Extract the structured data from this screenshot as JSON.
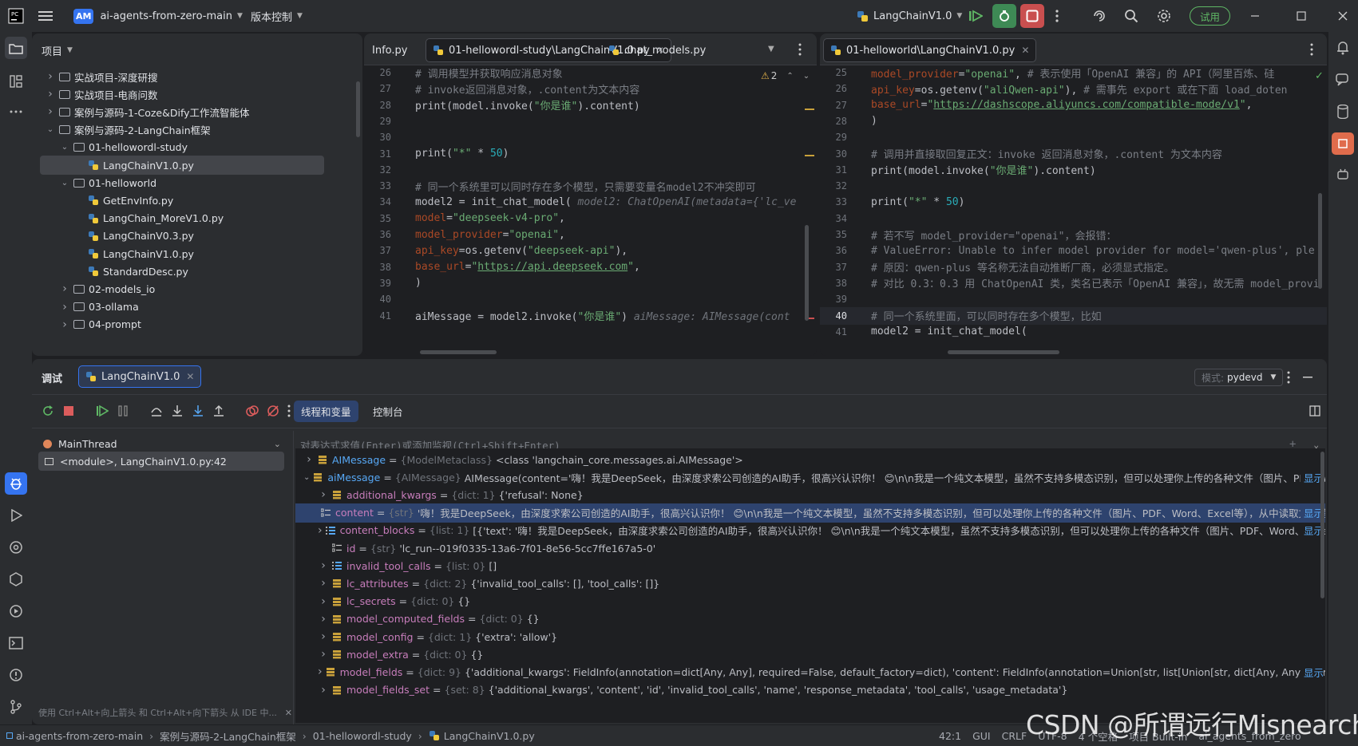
{
  "titlebar": {
    "project_badge": "AM",
    "project_name": "ai-agents-from-zero-main",
    "vcs_menu": "版本控制",
    "run_config": "LangChainV1.0",
    "trial_button": "试用"
  },
  "project_panel": {
    "title": "项目",
    "items": [
      {
        "label": "实战项目-深度研搜",
        "kind": "folder",
        "expanded": false
      },
      {
        "label": "实战项目-电商问数",
        "kind": "folder",
        "expanded": false
      },
      {
        "label": "案例与源码-1-Coze&Dify工作流智能体",
        "kind": "folder",
        "expanded": false
      },
      {
        "label": "案例与源码-2-LangChain框架",
        "kind": "folder",
        "expanded": true
      },
      {
        "label": "01-hellowordl-study",
        "kind": "folder",
        "expanded": true
      },
      {
        "label": "LangChainV1.0.py",
        "kind": "py",
        "selected": true
      },
      {
        "label": "01-helloworld",
        "kind": "folder",
        "expanded": true
      },
      {
        "label": "GetEnvInfo.py",
        "kind": "py"
      },
      {
        "label": "LangChain_MoreV1.0.py",
        "kind": "py"
      },
      {
        "label": "LangChainV0.3.py",
        "kind": "py"
      },
      {
        "label": "LangChainV1.0.py",
        "kind": "py"
      },
      {
        "label": "StandardDesc.py",
        "kind": "py"
      },
      {
        "label": "02-models_io",
        "kind": "folder",
        "expanded": false
      },
      {
        "label": "03-ollama",
        "kind": "folder",
        "expanded": false
      },
      {
        "label": "04-prompt",
        "kind": "folder",
        "expanded": false
      }
    ]
  },
  "editor1": {
    "tabs": [
      "Info.py",
      "01-hellowordl-study\\LangChainV1.0.py",
      "chat_models.py"
    ],
    "warnings": "2",
    "lines": [
      {
        "n": "26",
        "parts": [
          [
            "cm",
            "# 调用模型并获取响应消息对象"
          ]
        ]
      },
      {
        "n": "27",
        "parts": [
          [
            "cm",
            "# invoke返回消息对象，.content为文本内容"
          ]
        ]
      },
      {
        "n": "28",
        "parts": [
          [
            "fn",
            "print(model.invoke("
          ],
          [
            "str",
            "\"你是谁\""
          ],
          [
            "fn",
            ").content)"
          ]
        ]
      },
      {
        "n": "29",
        "parts": []
      },
      {
        "n": "30",
        "parts": []
      },
      {
        "n": "31",
        "parts": [
          [
            "fn",
            "print("
          ],
          [
            "str",
            "\"*\""
          ],
          [
            "fn",
            " * "
          ],
          [
            "num",
            "50"
          ],
          [
            "fn",
            ")"
          ]
        ]
      },
      {
        "n": "32",
        "parts": []
      },
      {
        "n": "33",
        "parts": [
          [
            "cm",
            "# 同一个系统里可以同时存在多个模型，只需要变量名model2不冲突即可"
          ]
        ]
      },
      {
        "n": "34",
        "parts": [
          [
            "fn",
            "model2 = init_chat_model(  "
          ],
          [
            "hint",
            "model2: ChatOpenAI(metadata={'lc_ve"
          ]
        ]
      },
      {
        "n": "35",
        "parts": [
          [
            "fn",
            "    "
          ],
          [
            "named",
            "model"
          ],
          [
            "fn",
            "="
          ],
          [
            "str",
            "\"deepseek-v4-pro\""
          ],
          [
            "fn",
            ","
          ]
        ]
      },
      {
        "n": "36",
        "parts": [
          [
            "fn",
            "    "
          ],
          [
            "named",
            "model_provider"
          ],
          [
            "fn",
            "="
          ],
          [
            "str",
            "\"openai\""
          ],
          [
            "fn",
            ","
          ]
        ]
      },
      {
        "n": "37",
        "parts": [
          [
            "fn",
            "    "
          ],
          [
            "named",
            "api_key"
          ],
          [
            "fn",
            "=os.getenv("
          ],
          [
            "str",
            "\"deepseek-api\""
          ],
          [
            "fn",
            "),"
          ]
        ]
      },
      {
        "n": "38",
        "parts": [
          [
            "fn",
            "    "
          ],
          [
            "named",
            "base_url"
          ],
          [
            "fn",
            "="
          ],
          [
            "str",
            "\""
          ],
          [
            "url",
            "https://api.deepseek.com"
          ],
          [
            "str",
            "\""
          ],
          [
            "fn",
            ","
          ]
        ]
      },
      {
        "n": "39",
        "parts": [
          [
            "fn",
            ")"
          ]
        ]
      },
      {
        "n": "40",
        "parts": []
      },
      {
        "n": "41",
        "parts": [
          [
            "fn",
            "aiMessage =  model2.invoke("
          ],
          [
            "str",
            "\"你是谁\""
          ],
          [
            "fn",
            ")  "
          ],
          [
            "hint",
            "aiMessage: AIMessage(cont"
          ]
        ]
      }
    ]
  },
  "editor2": {
    "tab": "01-helloworld\\LangChainV1.0.py",
    "lines": [
      {
        "n": "25",
        "parts": [
          [
            "fn",
            "    "
          ],
          [
            "named",
            "model_provider"
          ],
          [
            "fn",
            "="
          ],
          [
            "str",
            "\"openai\""
          ],
          [
            "fn",
            ",  "
          ],
          [
            "cm",
            "# 表示使用「OpenAI 兼容」的 API（阿里百炼、硅"
          ]
        ]
      },
      {
        "n": "26",
        "parts": [
          [
            "fn",
            "    "
          ],
          [
            "named",
            "api_key"
          ],
          [
            "fn",
            "=os.getenv("
          ],
          [
            "str",
            "\"aliQwen-api\""
          ],
          [
            "fn",
            "),  "
          ],
          [
            "cm",
            "# 需事先 export 或在下面 load_doten"
          ]
        ]
      },
      {
        "n": "27",
        "parts": [
          [
            "fn",
            "    "
          ],
          [
            "named",
            "base_url"
          ],
          [
            "fn",
            "="
          ],
          [
            "str",
            "\""
          ],
          [
            "url",
            "https://dashscope.aliyuncs.com/compatible-mode/v1"
          ],
          [
            "str",
            "\""
          ],
          [
            "fn",
            ","
          ]
        ]
      },
      {
        "n": "28",
        "parts": [
          [
            "fn",
            ")"
          ]
        ]
      },
      {
        "n": "29",
        "parts": []
      },
      {
        "n": "30",
        "parts": [
          [
            "cm",
            "# 调用并直接取回复正文：invoke 返回消息对象，.content 为文本内容"
          ]
        ]
      },
      {
        "n": "31",
        "parts": [
          [
            "fn",
            "print(model.invoke("
          ],
          [
            "str",
            "\"你是谁\""
          ],
          [
            "fn",
            ").content)"
          ]
        ]
      },
      {
        "n": "32",
        "parts": []
      },
      {
        "n": "33",
        "parts": [
          [
            "fn",
            "print("
          ],
          [
            "str",
            "\"*\""
          ],
          [
            "fn",
            " * "
          ],
          [
            "num",
            "50"
          ],
          [
            "fn",
            ")"
          ]
        ]
      },
      {
        "n": "34",
        "parts": []
      },
      {
        "n": "35",
        "parts": [
          [
            "cm",
            "# 若不写 model_provider=\"openai\"，会报错："
          ]
        ]
      },
      {
        "n": "36",
        "parts": [
          [
            "cm",
            "# ValueError: Unable to infer model provider for model='qwen-plus', ple"
          ]
        ]
      },
      {
        "n": "37",
        "parts": [
          [
            "cm",
            "# 原因：qwen-plus 等名称无法自动推断厂商，必须显式指定。"
          ]
        ]
      },
      {
        "n": "38",
        "parts": [
          [
            "cm",
            "# 对比 0.3：0.3 用 ChatOpenAI 类，类名已表示「OpenAI 兼容」，故无需 model_provi"
          ]
        ]
      },
      {
        "n": "39",
        "parts": []
      },
      {
        "n": "40",
        "parts": [
          [
            "cm",
            "# 同一个系统里面，可以同时存在多个模型，比如"
          ]
        ]
      },
      {
        "n": "41",
        "parts": [
          [
            "fn",
            "model2 = init_chat_model("
          ]
        ]
      }
    ]
  },
  "debug": {
    "title": "调试",
    "session_tab": "LangChainV1.0",
    "mode_label": "模式:",
    "mode_value": "pydevd",
    "subtab_vars": "线程和变量",
    "subtab_console": "控制台",
    "thread": "MainThread",
    "frame": "<module>, LangChainV1.0.py:42",
    "hint_text": "使用 Ctrl+Alt+向上箭头 和 Ctrl+Alt+向下箭头 从 IDE 中...",
    "eval_placeholder": "对表达式求值(Enter)或添加监视(Ctrl+Shift+Enter)",
    "variables": [
      {
        "indent": 0,
        "chev": "right",
        "name": "AIMessage",
        "type": "{ModelMetaclass}",
        "value": "<class 'langchain_core.messages.ai.AIMessage'>",
        "show": false,
        "icon": "var"
      },
      {
        "indent": 0,
        "chev": "down",
        "name": "aiMessage",
        "type": "{AIMessage}",
        "value": "AIMessage(content='嗨！我是DeepSeek，由深度求索公司创造的AI助手，很高兴认识你！ 😊\\n\\n我是一个纯文本模型，虽然不支持多模态识别，但可以处理你上传的各种文件（图片、PDF、Wor...",
        "show": true,
        "icon": "var"
      },
      {
        "indent": 1,
        "chev": "right",
        "name": "additional_kwargs",
        "type": "{dict: 1}",
        "value": "{'refusal': None}",
        "show": false,
        "icon": "var"
      },
      {
        "indent": 1,
        "chev": "none",
        "name": "content",
        "type": "{str}",
        "value": "'嗨！我是DeepSeek，由深度求索公司创造的AI助手，很高兴认识你！ 😊\\n\\n我是一个纯文本模型，虽然不支持多模态识别，但可以处理你上传的各种文件（图片、PDF、Word、Excel等），从中读取文字信...",
        "show": true,
        "selected": true,
        "icon": "field"
      },
      {
        "indent": 1,
        "chev": "right",
        "name": "content_blocks",
        "type": "{list: 1}",
        "value": "[{'text': '嗨！我是DeepSeek，由深度求索公司创造的AI助手，很高兴认识你！ 😊\\n\\n我是一个纯文本模型，虽然不支持多模态识别，但可以处理你上传的各种文件（图片、PDF、Word、Excel等）...",
        "show": true,
        "icon": "list"
      },
      {
        "indent": 1,
        "chev": "none",
        "name": "id",
        "type": "{str}",
        "value": "'lc_run--019f0335-13a6-7f01-8e56-5cc7ffe167a5-0'",
        "show": false,
        "icon": "field"
      },
      {
        "indent": 1,
        "chev": "right",
        "name": "invalid_tool_calls",
        "type": "{list: 0}",
        "value": "[]",
        "show": false,
        "icon": "list"
      },
      {
        "indent": 1,
        "chev": "right",
        "name": "lc_attributes",
        "type": "{dict: 2}",
        "value": "{'invalid_tool_calls': [], 'tool_calls': []}",
        "show": false,
        "icon": "var"
      },
      {
        "indent": 1,
        "chev": "right",
        "name": "lc_secrets",
        "type": "{dict: 0}",
        "value": "{}",
        "show": false,
        "icon": "var"
      },
      {
        "indent": 1,
        "chev": "right",
        "name": "model_computed_fields",
        "type": "{dict: 0}",
        "value": "{}",
        "show": false,
        "icon": "var"
      },
      {
        "indent": 1,
        "chev": "right",
        "name": "model_config",
        "type": "{dict: 1}",
        "value": "{'extra': 'allow'}",
        "show": false,
        "icon": "var"
      },
      {
        "indent": 1,
        "chev": "right",
        "name": "model_extra",
        "type": "{dict: 0}",
        "value": "{}",
        "show": false,
        "icon": "var"
      },
      {
        "indent": 1,
        "chev": "right",
        "name": "model_fields",
        "type": "{dict: 9}",
        "value": "{'additional_kwargs': FieldInfo(annotation=dict[Any, Any], required=False, default_factory=dict), 'content': FieldInfo(annotation=Union[str, list[Union[str, dict[Any, Any]]]], required=Tru...",
        "show": true,
        "icon": "var"
      },
      {
        "indent": 1,
        "chev": "right",
        "name": "model_fields_set",
        "type": "{set: 8}",
        "value": "{'additional_kwargs', 'content', 'id', 'invalid_tool_calls', 'name', 'response_metadata', 'tool_calls', 'usage_metadata'}",
        "show": false,
        "icon": "var"
      }
    ],
    "show_label": "显示"
  },
  "statusbar": {
    "breadcrumbs": [
      "ai-agents-from-zero-main",
      "案例与源码-2-LangChain框架",
      "01-hellowordl-study",
      "LangChainV1.0.py"
    ],
    "position": "42:1",
    "gui": "GUI",
    "line_sep": "CRLF",
    "encoding": "UTF-8",
    "indent": "4 个空格",
    "interpreter": "项目 Built-in",
    "env": "ai_agents_from_zero"
  },
  "watermark": "CSDN @所谓远行Misnearch",
  "colors": {
    "accent": "#3574f0",
    "stop": "#db5c5c",
    "trial": "#5fb865"
  }
}
